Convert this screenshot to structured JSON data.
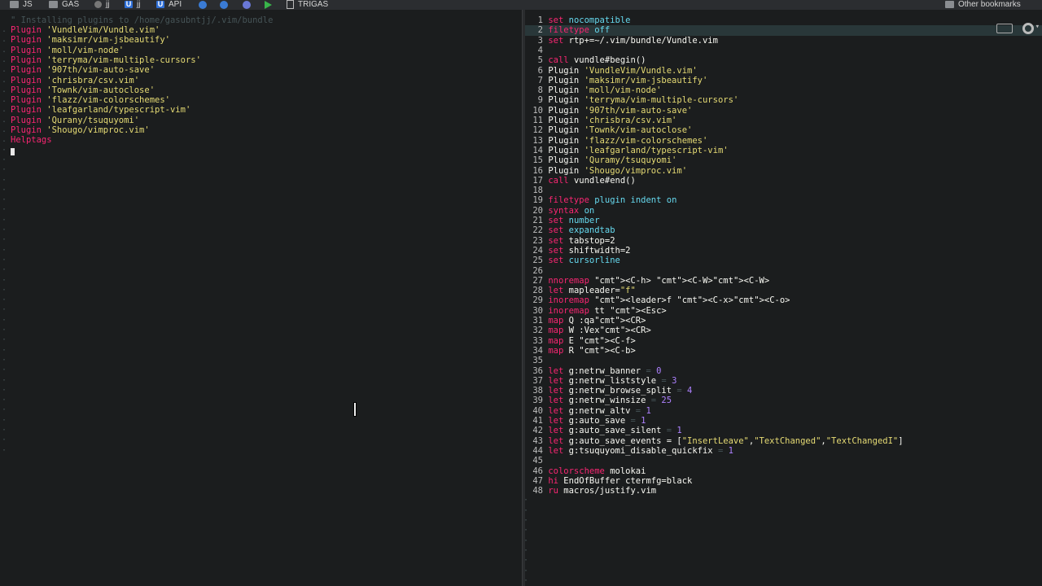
{
  "bookmarks": {
    "items": [
      {
        "label": "JS",
        "icon": "folder-icon"
      },
      {
        "label": "GAS",
        "icon": "folder-icon"
      },
      {
        "label": "jj",
        "icon": "circle-icon"
      },
      {
        "label": "jj",
        "icon": "u-icon"
      },
      {
        "label": "API",
        "icon": "u-icon"
      },
      {
        "label": "",
        "icon": "app-icon"
      },
      {
        "label": "",
        "icon": "call-icon"
      },
      {
        "label": "",
        "icon": "discord-icon"
      },
      {
        "label": "",
        "icon": "play-icon"
      },
      {
        "label": "TRIGAS",
        "icon": "doc-icon"
      }
    ],
    "other": "Other bookmarks"
  },
  "left_pane": {
    "header_comment": "\" Installing plugins to /home/gasubntjj/.vim/bundle",
    "plugins": [
      "Plugin 'VundleVim/Vundle.vim'",
      "Plugin 'maksimr/vim-jsbeautify'",
      "Plugin 'moll/vim-node'",
      "Plugin 'terryma/vim-multiple-cursors'",
      "Plugin '907th/vim-auto-save'",
      "Plugin 'chrisbra/csv.vim'",
      "Plugin 'Townk/vim-autoclose'",
      "Plugin 'flazz/vim-colorschemes'",
      "Plugin 'leafgarland/typescript-vim'",
      "Plugin 'Qurany/tsuquyomi'",
      "Plugin 'Shougo/vimproc.vim'"
    ],
    "helptags": "Helptags"
  },
  "right_pane": {
    "lines": [
      {
        "n": "1",
        "t": "set nocompatible"
      },
      {
        "n": "2",
        "t": "filetype off"
      },
      {
        "n": "3",
        "t": "set rtp+=~/.vim/bundle/Vundle.vim"
      },
      {
        "n": "4",
        "t": ""
      },
      {
        "n": "5",
        "t": "call vundle#begin()"
      },
      {
        "n": "6",
        "t": "Plugin 'VundleVim/Vundle.vim'"
      },
      {
        "n": "7",
        "t": "Plugin 'maksimr/vim-jsbeautify'"
      },
      {
        "n": "8",
        "t": "Plugin 'moll/vim-node'"
      },
      {
        "n": "9",
        "t": "Plugin 'terryma/vim-multiple-cursors'"
      },
      {
        "n": "10",
        "t": "Plugin '907th/vim-auto-save'"
      },
      {
        "n": "11",
        "t": "Plugin 'chrisbra/csv.vim'"
      },
      {
        "n": "12",
        "t": "Plugin 'Townk/vim-autoclose'"
      },
      {
        "n": "13",
        "t": "Plugin 'flazz/vim-colorschemes'"
      },
      {
        "n": "14",
        "t": "Plugin 'leafgarland/typescript-vim'"
      },
      {
        "n": "15",
        "t": "Plugin 'Quramy/tsuquyomi'"
      },
      {
        "n": "16",
        "t": "Plugin 'Shougo/vimproc.vim'"
      },
      {
        "n": "17",
        "t": "call vundle#end()"
      },
      {
        "n": "18",
        "t": ""
      },
      {
        "n": "19",
        "t": "filetype plugin indent on"
      },
      {
        "n": "20",
        "t": "syntax on"
      },
      {
        "n": "21",
        "t": "set number"
      },
      {
        "n": "22",
        "t": "set expandtab"
      },
      {
        "n": "23",
        "t": "set tabstop=2"
      },
      {
        "n": "24",
        "t": "set shiftwidth=2"
      },
      {
        "n": "25",
        "t": "set cursorline"
      },
      {
        "n": "26",
        "t": ""
      },
      {
        "n": "27",
        "t": "nnoremap <C-h> <C-W><C-W>"
      },
      {
        "n": "28",
        "t": "let mapleader=\"f\""
      },
      {
        "n": "29",
        "t": "inoremap <leader>f <C-x><C-o>"
      },
      {
        "n": "30",
        "t": "inoremap tt <Esc>"
      },
      {
        "n": "31",
        "t": "map Q :qa<CR>"
      },
      {
        "n": "32",
        "t": "map W :Vex<CR>"
      },
      {
        "n": "33",
        "t": "map E <C-f>"
      },
      {
        "n": "34",
        "t": "map R <C-b>"
      },
      {
        "n": "35",
        "t": ""
      },
      {
        "n": "36",
        "t": "let g:netrw_banner = 0"
      },
      {
        "n": "37",
        "t": "let g:netrw_liststyle = 3"
      },
      {
        "n": "38",
        "t": "let g:netrw_browse_split = 4"
      },
      {
        "n": "39",
        "t": "let g:netrw_winsize = 25"
      },
      {
        "n": "40",
        "t": "let g:netrw_altv = 1"
      },
      {
        "n": "41",
        "t": "let g:auto_save = 1"
      },
      {
        "n": "42",
        "t": "let g:auto_save_silent = 1"
      },
      {
        "n": "43",
        "t": "let g:auto_save_events = [\"InsertLeave\",\"TextChanged\",\"TextChangedI\"]"
      },
      {
        "n": "44",
        "t": "let g:tsuquyomi_disable_quickfix = 1"
      },
      {
        "n": "45",
        "t": ""
      },
      {
        "n": "46",
        "t": "colorscheme molokai"
      },
      {
        "n": "47",
        "t": "hi EndOfBuffer ctermfg=black"
      },
      {
        "n": "48",
        "t": "ru macros/justify.vim"
      }
    ]
  },
  "colors": {
    "keyword": "#f92672",
    "string": "#e6db74",
    "number": "#ae81ff",
    "comment": "#465457",
    "ident": "#66d9ef"
  }
}
